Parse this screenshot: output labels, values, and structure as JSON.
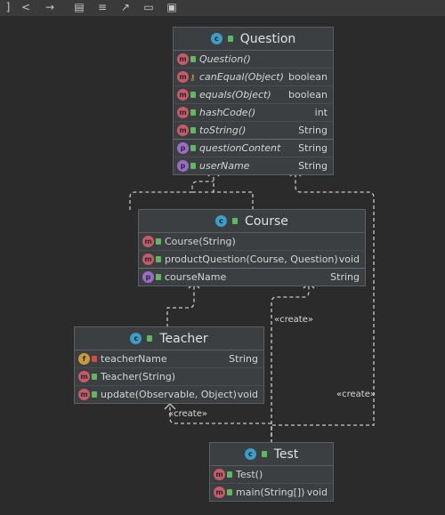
{
  "toolbar": {
    "icons": [
      "bracket-icon",
      "share-icon",
      "arrow-right-icon",
      "copy-icon",
      "align-icon",
      "export-icon",
      "print-icon",
      "save-icon"
    ]
  },
  "classes": {
    "question": {
      "title": "Question",
      "rows": [
        {
          "badge": "m",
          "name": "Question()",
          "type": "",
          "italic": true
        },
        {
          "badge": "m",
          "name": "canEqual(Object)",
          "type": "boolean",
          "italic": true,
          "key": true
        },
        {
          "badge": "m",
          "name": "equals(Object)",
          "type": "boolean",
          "italic": true
        },
        {
          "badge": "m",
          "name": "hashCode()",
          "type": "int",
          "italic": true
        },
        {
          "badge": "m",
          "name": "toString()",
          "type": "String",
          "italic": true
        },
        {
          "badge": "p",
          "name": "questionContent",
          "type": "String",
          "italic": true
        },
        {
          "badge": "p",
          "name": "userName",
          "type": "String",
          "italic": true
        }
      ]
    },
    "course": {
      "title": "Course",
      "rows": [
        {
          "badge": "m",
          "name": "Course(String)",
          "type": ""
        },
        {
          "badge": "m",
          "name": "productQuestion(Course, Question)",
          "type": "void"
        },
        {
          "badge": "p",
          "name": "courseName",
          "type": "String"
        }
      ]
    },
    "teacher": {
      "title": "Teacher",
      "rows": [
        {
          "badge": "f",
          "name": "teacherName",
          "type": "String"
        },
        {
          "badge": "m",
          "name": "Teacher(String)",
          "type": ""
        },
        {
          "badge": "m",
          "name": "update(Observable, Object)",
          "type": "void"
        }
      ]
    },
    "test": {
      "title": "Test",
      "rows": [
        {
          "badge": "m",
          "name": "Test()",
          "type": ""
        },
        {
          "badge": "m",
          "name": "main(String[])",
          "type": "void"
        }
      ]
    }
  },
  "edge_labels": {
    "create1": "«create»",
    "create2": "«create»",
    "create3": "«create»"
  }
}
